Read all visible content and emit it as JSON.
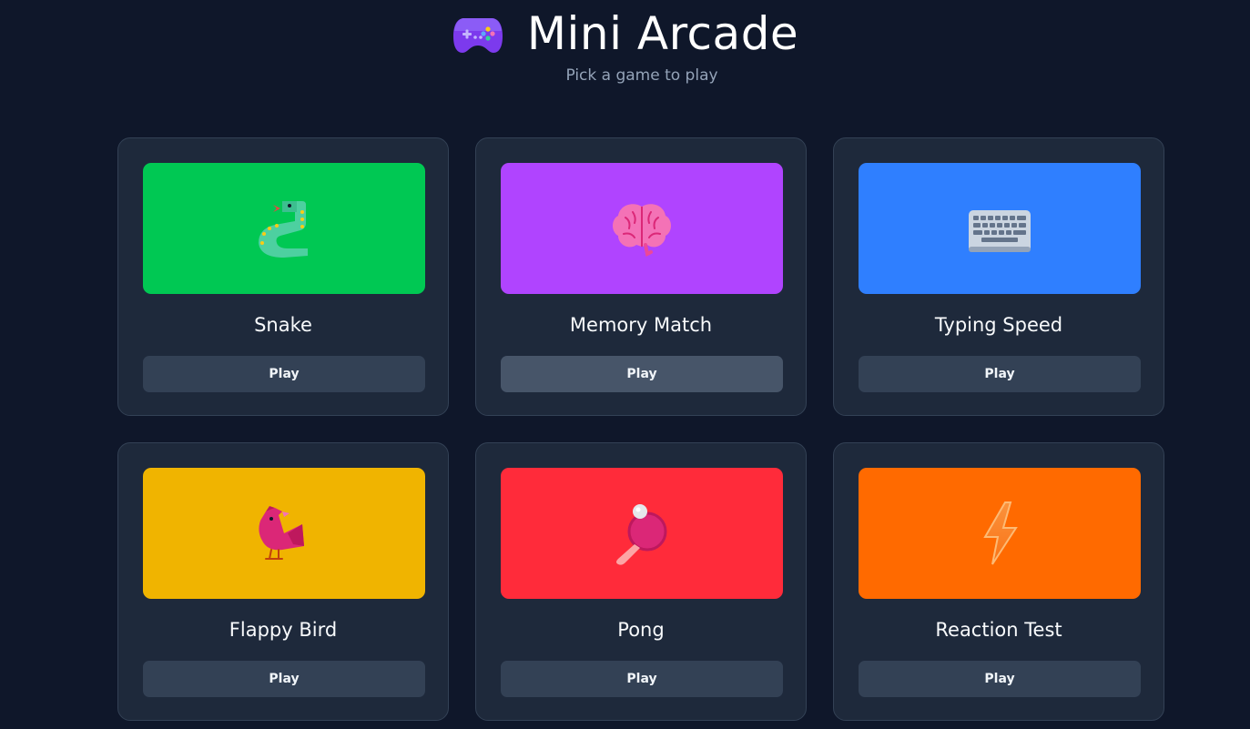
{
  "header": {
    "title": "Mini Arcade",
    "subtitle": "Pick a game to play",
    "icon": "gamepad-icon"
  },
  "games": [
    {
      "title": "Snake",
      "play_label": "Play",
      "color": "#00c853",
      "icon": "snake-icon"
    },
    {
      "title": "Memory Match",
      "play_label": "Play",
      "color": "#b044ff",
      "icon": "brain-icon"
    },
    {
      "title": "Typing Speed",
      "play_label": "Play",
      "color": "#2f7fff",
      "icon": "keyboard-icon"
    },
    {
      "title": "Flappy Bird",
      "play_label": "Play",
      "color": "#f0b400",
      "icon": "bird-icon"
    },
    {
      "title": "Pong",
      "play_label": "Play",
      "color": "#ff2b3a",
      "icon": "ping-pong-icon"
    },
    {
      "title": "Reaction Test",
      "play_label": "Play",
      "color": "#ff6a00",
      "icon": "lightning-icon"
    }
  ]
}
